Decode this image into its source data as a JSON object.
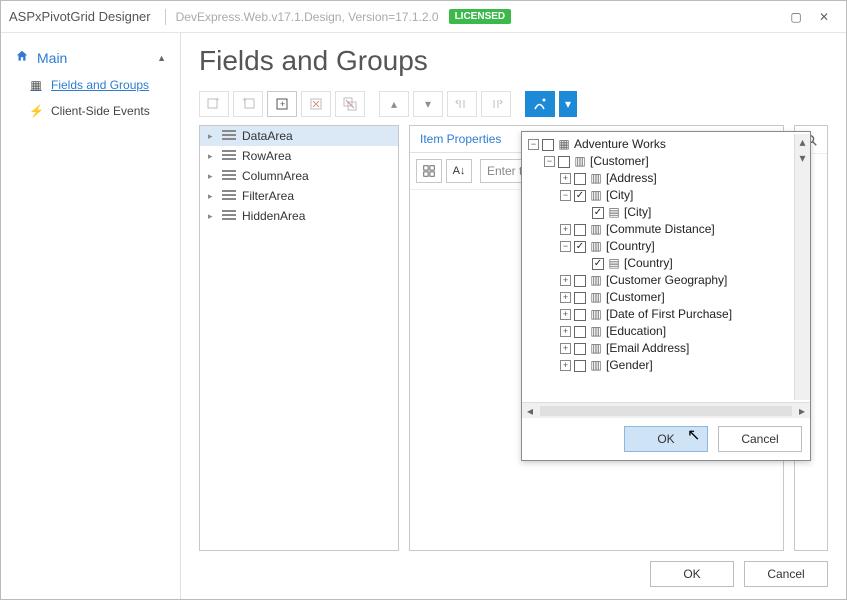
{
  "window": {
    "title": "ASPxPivotGrid Designer",
    "version": "DevExpress.Web.v17.1.Design, Version=17.1.2.0",
    "badge": "LICENSED"
  },
  "sidebar": {
    "header": "Main",
    "items": [
      {
        "label": "Fields and Groups",
        "active": true
      },
      {
        "label": "Client-Side Events",
        "active": false
      }
    ]
  },
  "page": {
    "title": "Fields and Groups"
  },
  "areas": [
    {
      "label": "DataArea",
      "selected": true
    },
    {
      "label": "RowArea",
      "selected": false
    },
    {
      "label": "ColumnArea",
      "selected": false
    },
    {
      "label": "FilterArea",
      "selected": false
    },
    {
      "label": "HiddenArea",
      "selected": false
    }
  ],
  "properties": {
    "tab": "Item Properties",
    "search_placeholder": "Enter te"
  },
  "dialog_buttons": {
    "ok": "OK",
    "cancel": "Cancel"
  },
  "popup": {
    "buttons": {
      "ok": "OK",
      "cancel": "Cancel"
    },
    "tree": [
      {
        "depth": 0,
        "twist": "−",
        "checked": false,
        "icon": "cube",
        "label": "Adventure Works"
      },
      {
        "depth": 1,
        "twist": "−",
        "checked": false,
        "icon": "dim",
        "label": "[Customer]"
      },
      {
        "depth": 2,
        "twist": "+",
        "checked": false,
        "icon": "dim",
        "label": "[Address]"
      },
      {
        "depth": 2,
        "twist": "−",
        "checked": true,
        "icon": "dim",
        "label": "[City]"
      },
      {
        "depth": 3,
        "twist": "",
        "checked": true,
        "icon": "attr",
        "label": "[City]"
      },
      {
        "depth": 2,
        "twist": "+",
        "checked": false,
        "icon": "dim",
        "label": "[Commute Distance]"
      },
      {
        "depth": 2,
        "twist": "−",
        "checked": true,
        "icon": "dim",
        "label": "[Country]"
      },
      {
        "depth": 3,
        "twist": "",
        "checked": true,
        "icon": "attr",
        "label": "[Country]"
      },
      {
        "depth": 2,
        "twist": "+",
        "checked": false,
        "icon": "dim",
        "label": "[Customer Geography]"
      },
      {
        "depth": 2,
        "twist": "+",
        "checked": false,
        "icon": "dim",
        "label": "[Customer]"
      },
      {
        "depth": 2,
        "twist": "+",
        "checked": false,
        "icon": "dim",
        "label": "[Date of First Purchase]"
      },
      {
        "depth": 2,
        "twist": "+",
        "checked": false,
        "icon": "dim",
        "label": "[Education]"
      },
      {
        "depth": 2,
        "twist": "+",
        "checked": false,
        "icon": "dim",
        "label": "[Email Address]"
      },
      {
        "depth": 2,
        "twist": "+",
        "checked": false,
        "icon": "dim",
        "label": "[Gender]"
      }
    ]
  }
}
